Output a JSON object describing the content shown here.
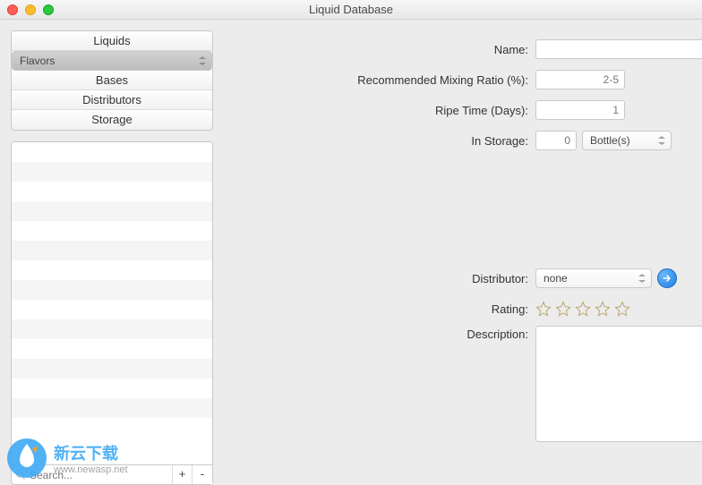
{
  "window": {
    "title": "Liquid Database"
  },
  "categories": [
    "Liquids",
    "Flavors",
    "Bases",
    "Distributors",
    "Storage"
  ],
  "selected_category_index": 1,
  "search": {
    "placeholder": "Search..."
  },
  "buttons": {
    "add": "+",
    "remove": "-"
  },
  "form": {
    "name": {
      "label": "Name:",
      "value": ""
    },
    "ratio": {
      "label": "Recommended Mixing Ratio (%):",
      "placeholder": "2-5"
    },
    "ripe": {
      "label": "Ripe Time (Days):",
      "placeholder": "1"
    },
    "storage": {
      "label": "In Storage:",
      "placeholder": "0",
      "unit": "Bottle(s)"
    },
    "distributor": {
      "label": "Distributor:",
      "value": "none"
    },
    "rating": {
      "label": "Rating:"
    },
    "description": {
      "label": "Description:",
      "value": ""
    },
    "help": "?"
  },
  "watermark": {
    "title": "新云下载",
    "url": "www.newasp.net"
  }
}
